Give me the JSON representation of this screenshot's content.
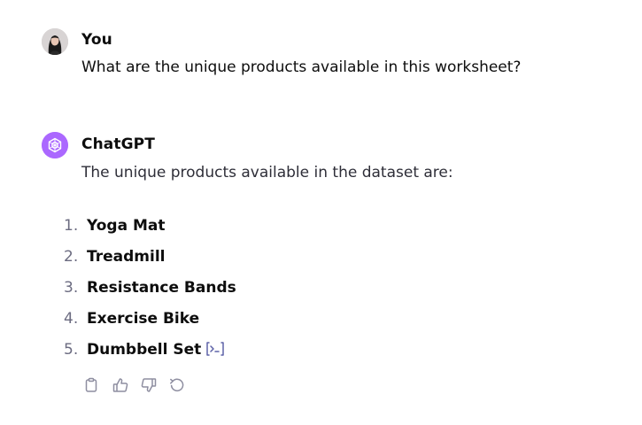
{
  "user": {
    "name": "You"
  },
  "question": "What are the unique products available in this worksheet?",
  "assistant": {
    "name": "ChatGPT"
  },
  "answer_intro": "The unique products available in the dataset are:",
  "products": [
    {
      "num": "1.",
      "label": "Yoga Mat"
    },
    {
      "num": "2.",
      "label": "Treadmill"
    },
    {
      "num": "3.",
      "label": "Resistance Bands"
    },
    {
      "num": "4.",
      "label": "Exercise Bike"
    },
    {
      "num": "5.",
      "label": "Dumbbell Set"
    }
  ],
  "icons": {
    "code": "code-interpreter-icon",
    "copy": "clipboard-icon",
    "like": "thumbs-up-icon",
    "dislike": "thumbs-down-icon",
    "regenerate": "regenerate-icon"
  },
  "colors": {
    "assistant_avatar": "#ab68ff",
    "code_icon": "#5f63a8",
    "action_icon": "#8e8ea0"
  }
}
